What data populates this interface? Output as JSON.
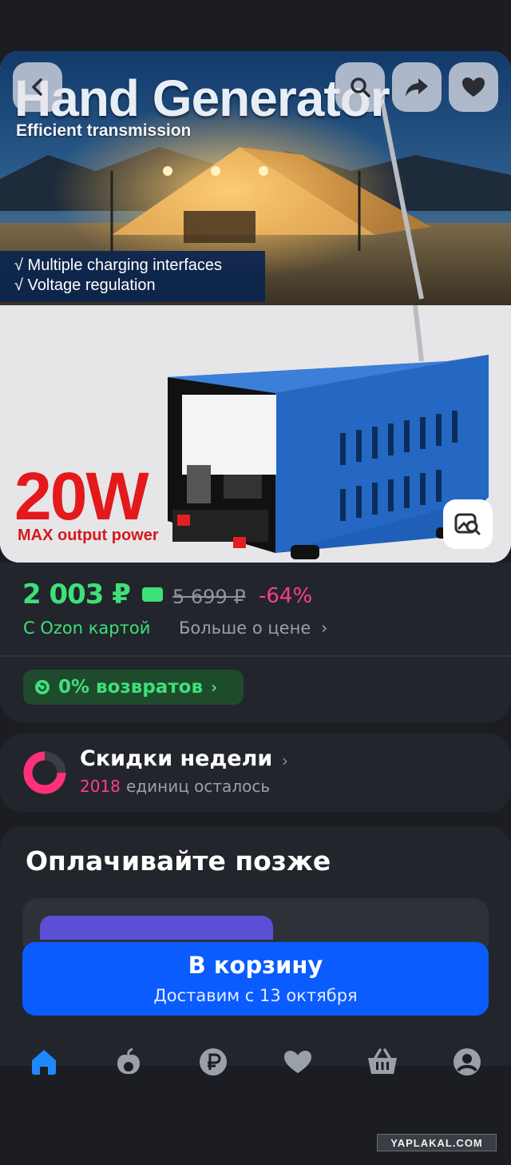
{
  "product_image": {
    "title": "Hand Generator",
    "subtitle": "Efficient transmission",
    "features": [
      "√ Multiple charging interfaces",
      "√ Voltage regulation"
    ],
    "power_value": "20W",
    "power_caption": "MAX output power"
  },
  "image_actions": {
    "back_icon": "chevron-left-icon",
    "search_icon": "search-icon",
    "share_icon": "share-icon",
    "favorite_icon": "heart-icon",
    "zoom_icon": "image-search-icon"
  },
  "price": {
    "current": "2 003 ₽",
    "old": "5 699 ₽",
    "discount": "-64%",
    "ozon_card_label": "С Ozon картой",
    "more_label": "Больше о цене",
    "more_chevron": "›"
  },
  "returns": {
    "label": "0% возвратов",
    "chevron": "›"
  },
  "weekly": {
    "title": "Скидки недели",
    "chevron": "›",
    "count": "2018",
    "unit_label": "единиц осталось"
  },
  "pay_later": {
    "title": "Оплачивайте позже"
  },
  "cart": {
    "label": "В корзину",
    "delivery": "Доставим с 13 октября"
  },
  "nav": [
    "home-icon",
    "fresh-icon",
    "ruble-icon",
    "favorites-icon",
    "cart-icon",
    "profile-icon"
  ],
  "colors": {
    "accent_green": "#3ee07a",
    "accent_pink": "#ff3d8e",
    "button_blue": "#0a5cff",
    "nav_active": "#1e88ff",
    "background": "#1b1d22"
  },
  "watermark": "YAPLAKAL.COM"
}
